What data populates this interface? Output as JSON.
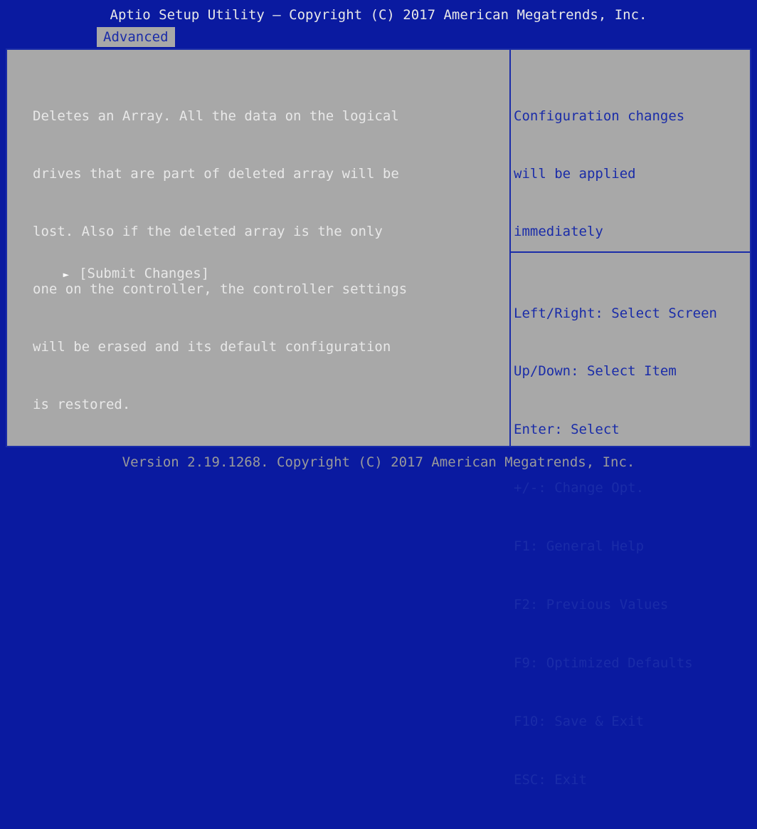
{
  "header": {
    "title": "Aptio Setup Utility – Copyright (C) 2017 American Megatrends, Inc.",
    "active_tab": "Advanced"
  },
  "main": {
    "description_lines": [
      "Deletes an Array. All the data on the logical",
      "drives that are part of deleted array will be",
      "lost. Also if the deleted array is the only",
      "one on the controller, the controller settings",
      "will be erased and its default configuration",
      "is restored."
    ],
    "menu_item": {
      "arrow": "►",
      "label": "[Submit Changes]"
    }
  },
  "help_panel": {
    "lines": [
      "Configuration changes",
      "will be applied",
      "immediately"
    ]
  },
  "key_legend": [
    "Left/Right: Select Screen",
    "Up/Down: Select Item",
    "Enter: Select",
    "+/-: Change Opt.",
    "F1: General Help",
    "F2: Previous Values",
    "F9: Optimized Defaults",
    "F10: Save & Exit",
    "ESC: Exit"
  ],
  "footer": {
    "version": "Version 2.19.1268. Copyright (C) 2017 American Megatrends, Inc."
  },
  "colors": {
    "frame_blue": "#0a1aa0",
    "panel_gray": "#a8a8a8",
    "text_white": "#e8e8e8",
    "help_blue": "#1a2ca8"
  }
}
